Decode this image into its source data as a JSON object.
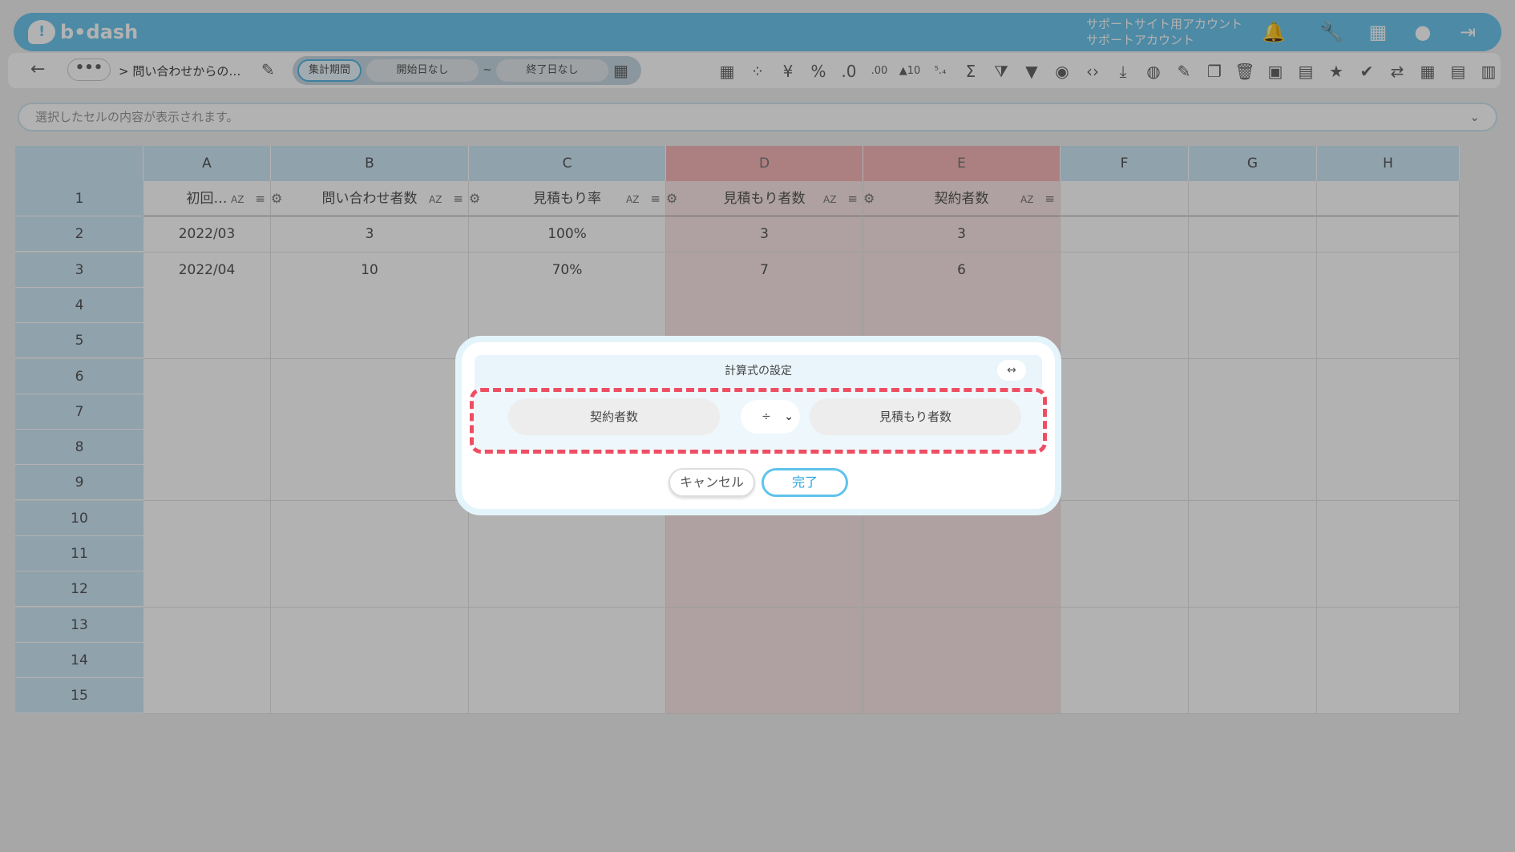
{
  "header": {
    "logo": "b•dash",
    "account_line1": "サポートサイト用アカウント",
    "account_line2": "サポートアカウント",
    "icons": [
      "bell-icon",
      "wrench-icon",
      "apps-grid-icon",
      "avatar-icon",
      "logout-icon"
    ]
  },
  "toolbar": {
    "more_label": "•••",
    "breadcrumb": "> 問い合わせからの…",
    "period_active": "集計期間",
    "start_date": "開始日なし",
    "tilde": "~",
    "end_date": "終了日なし",
    "icons": [
      "table-icon",
      "loading-icon",
      "yen-icon",
      "percent-icon",
      "decimal-decrease-icon",
      "decimal-increase-icon",
      "triangle-ten-icon",
      "abbrev-icon",
      "sigma-icon",
      "filter-clear-icon",
      "filter-icon",
      "eye-icon",
      "code-icon",
      "download-icon",
      "chart-icon",
      "edit-icon",
      "copy-icon",
      "trash-icon",
      "archive-icon",
      "restore-icon",
      "star-icon",
      "user-check-icon",
      "swap-icon",
      "calendar-icon",
      "document-icon",
      "clipboard-icon"
    ],
    "icon_glyphs": [
      "▦",
      "⁘",
      "¥",
      "%",
      ".0",
      ".00",
      "▲10",
      "⁵.₄",
      "Σ",
      "⧩",
      "▼",
      "◉",
      "‹›",
      "⤓",
      "◍",
      "✎",
      "❐",
      "🗑",
      "▣",
      "▤",
      "★",
      "✔",
      "⇄",
      "▦",
      "▤",
      "▥"
    ]
  },
  "formula_bar": {
    "placeholder": "選択したセルの内容が表示されます。",
    "chevron": "⌄"
  },
  "grid": {
    "columns": [
      "A",
      "B",
      "C",
      "D",
      "E",
      "F",
      "G",
      "H"
    ],
    "rows": [
      "1",
      "2",
      "3",
      "4",
      "5",
      "6",
      "7",
      "8",
      "9",
      "10",
      "11",
      "12",
      "13",
      "14",
      "15"
    ],
    "headers": [
      "初回…",
      "問い合わせ者数",
      "見積もり率",
      "見積もり者数",
      "契約者数"
    ],
    "sort_label": "AZ",
    "data": [
      [
        "2022/03",
        "3",
        "100%",
        "3",
        "3"
      ],
      [
        "2022/04",
        "10",
        "70%",
        "7",
        "6"
      ]
    ]
  },
  "dialog": {
    "title": "計算式の設定",
    "swap_label": "↔",
    "left_operand": "契約者数",
    "operator": "÷",
    "right_operand": "見積もり者数",
    "cancel_label": "キャンセル",
    "done_label": "完了"
  },
  "colors": {
    "brand": "#6fc6ec",
    "highlight": "#ee4e63",
    "header_cell": "#cfe8f6",
    "selected_col": "#f6b8b8"
  }
}
